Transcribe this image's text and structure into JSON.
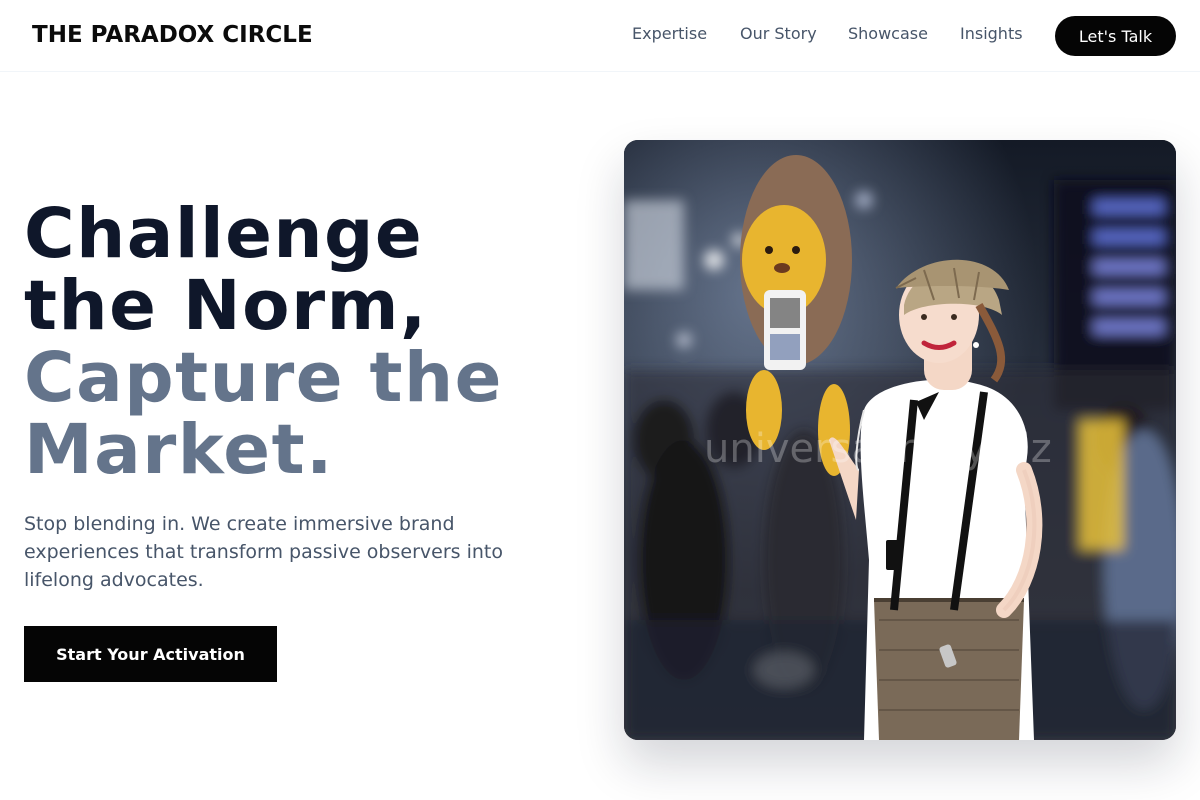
{
  "header": {
    "brand": "THE PARADOX CIRCLE",
    "nav": [
      {
        "label": "Expertise"
      },
      {
        "label": "Our Story"
      },
      {
        "label": "Showcase"
      },
      {
        "label": "Insights"
      }
    ],
    "cta_label": "Let's Talk"
  },
  "hero": {
    "title_lines": [
      "Challenge",
      "the Norm,",
      "Capture the",
      "Market."
    ],
    "subtitle": "Stop blending in. We create immersive brand experiences that transform passive observers into lifelong advocates.",
    "cta_label": "Start Your Activation"
  },
  "image": {
    "watermark": "universalirony.biz"
  },
  "colors": {
    "title_dark": "#0f172a",
    "title_muted": "#64748b",
    "button_bg": "#050505",
    "nav_text": "#475569"
  }
}
